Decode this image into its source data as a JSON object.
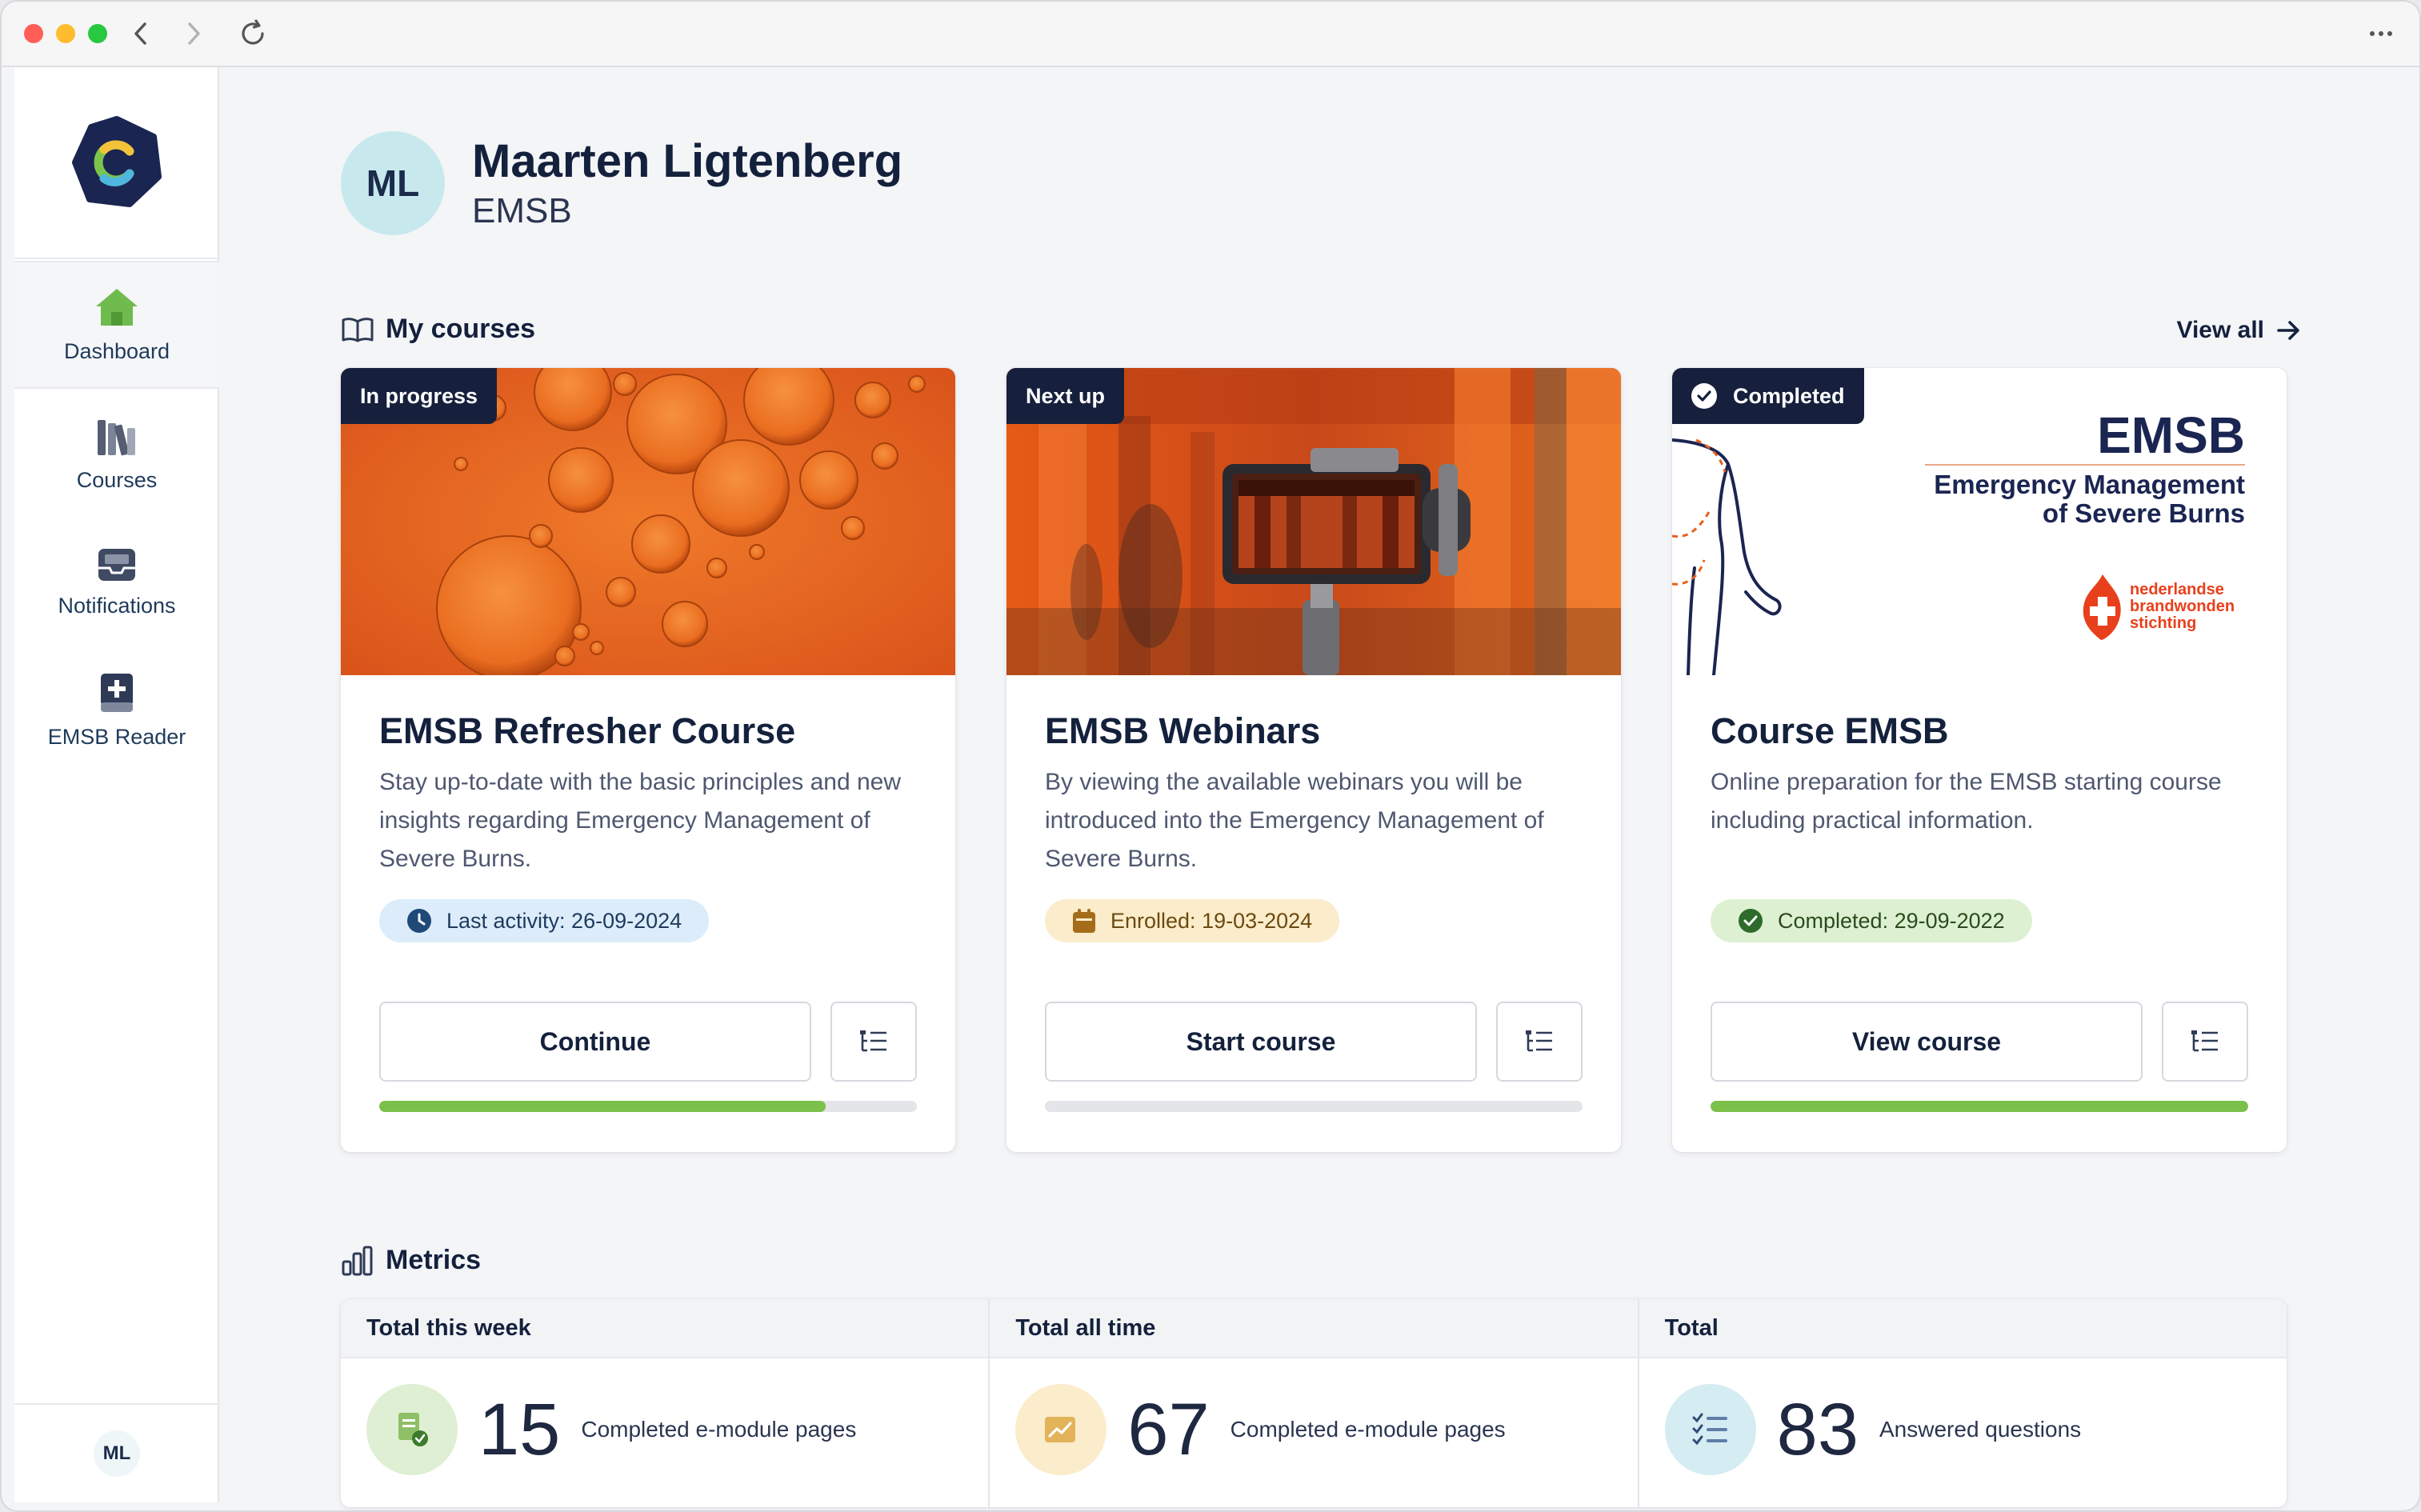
{
  "window": {
    "controls": [
      "close",
      "minimize",
      "zoom"
    ]
  },
  "sidebar": {
    "logo_letter": "C",
    "items": [
      {
        "label": "Dashboard",
        "icon": "home-icon",
        "active": true
      },
      {
        "label": "Courses",
        "icon": "books-icon",
        "active": false
      },
      {
        "label": "Notifications",
        "icon": "inbox-icon",
        "active": false
      },
      {
        "label": "EMSB Reader",
        "icon": "book-plus-icon",
        "active": false
      }
    ],
    "user_initials": "ML"
  },
  "profile": {
    "initials": "ML",
    "name": "Maarten Ligtenberg",
    "organization": "EMSB"
  },
  "courses_section": {
    "title": "My courses",
    "view_all": "View all",
    "cards": [
      {
        "badge": "In progress",
        "title": "EMSB Refresher Course",
        "description": "Stay up-to-date with the basic principles and new insights regarding Emergency Management of Severe Burns.",
        "chip": "Last activity: 26-09-2024",
        "button": "Continue",
        "progress": 0.83
      },
      {
        "badge": "Next up",
        "title": "EMSB Webinars",
        "description": "By viewing the available webinars you will be introduced into the Emergency Management of Severe Burns.",
        "chip": "Enrolled: 19-03-2024",
        "button": "Start course",
        "progress": 0
      },
      {
        "badge": "Completed",
        "title": "Course EMSB",
        "description": "Online preparation for the EMSB starting course including practical information.",
        "chip": "Completed: 29-09-2022",
        "button": "View course",
        "progress": 1.0,
        "image_text": {
          "brand": "EMSB",
          "line1": "Emergency Management",
          "line2": "of Severe Burns",
          "partner1": "nederlandse",
          "partner2": "brandwonden",
          "partner3": "stichting"
        }
      }
    ]
  },
  "metrics_section": {
    "title": "Metrics",
    "items": [
      {
        "header": "Total this week",
        "value": "15",
        "label": "Completed e-module pages"
      },
      {
        "header": "Total all time",
        "value": "67",
        "label": "Completed e-module pages"
      },
      {
        "header": "Total",
        "value": "83",
        "label": "Answered questions"
      }
    ]
  },
  "colors": {
    "navy": "#16203d",
    "progress_green": "#7bc04a",
    "orange": "#e8601c"
  }
}
